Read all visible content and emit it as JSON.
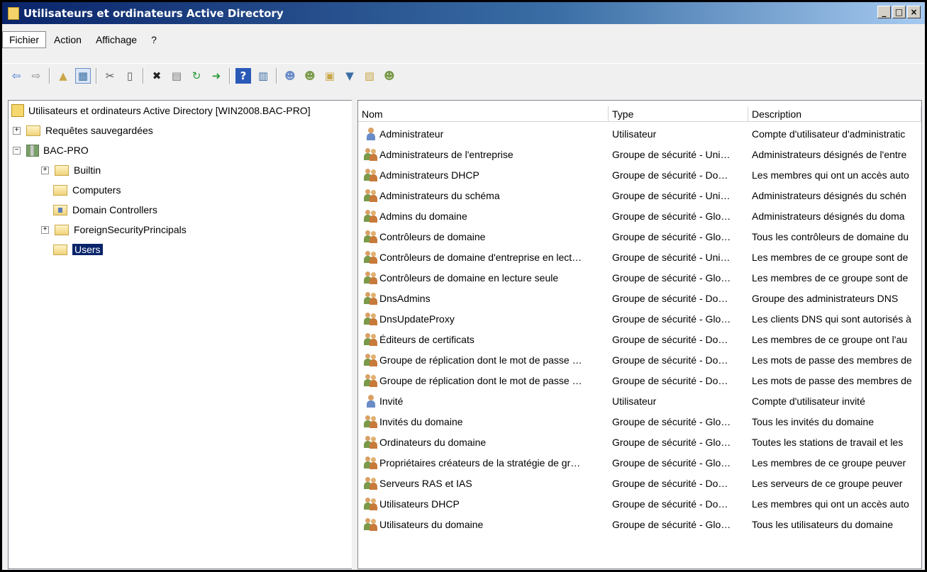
{
  "window": {
    "title": "Utilisateurs et ordinateurs Active Directory"
  },
  "window_buttons": [
    "_",
    "□",
    "×"
  ],
  "menu": [
    "Fichier",
    "Action",
    "Affichage",
    "?"
  ],
  "toolbar_icons": [
    "back-arrow-icon",
    "forward-arrow-icon",
    "up-folder-icon",
    "show-tree-icon",
    "cut-icon",
    "copy-icon",
    "delete-icon",
    "properties-icon",
    "refresh-icon",
    "export-icon",
    "help-icon",
    "view-icon",
    "new-user-icon",
    "new-group-icon",
    "new-ou-icon",
    "filter-icon",
    "add-to-group-icon",
    "find-icon"
  ],
  "tree": {
    "root": "Utilisateurs et ordinateurs Active Directory [WIN2008.BAC-PRO]",
    "saved_queries": "Requêtes sauvegardées",
    "domain": "BAC-PRO",
    "children": [
      "Builtin",
      "Computers",
      "Domain Controllers",
      "ForeignSecurityPrincipals",
      "Users"
    ],
    "selected": "Users"
  },
  "list": {
    "columns": [
      "Nom",
      "Type",
      "Description"
    ],
    "rows": [
      {
        "icon": "user",
        "name": "Administrateur",
        "type": "Utilisateur",
        "description": "Compte d'utilisateur d'administratic"
      },
      {
        "icon": "group",
        "name": "Administrateurs de l'entreprise",
        "type": "Groupe de sécurité - Uni…",
        "description": "Administrateurs désignés de l'entre"
      },
      {
        "icon": "group",
        "name": "Administrateurs DHCP",
        "type": "Groupe de sécurité - Do…",
        "description": "Les membres qui ont un accès auto"
      },
      {
        "icon": "group",
        "name": "Administrateurs du schéma",
        "type": "Groupe de sécurité - Uni…",
        "description": "Administrateurs désignés du schén"
      },
      {
        "icon": "group",
        "name": "Admins du domaine",
        "type": "Groupe de sécurité - Glo…",
        "description": "Administrateurs désignés du doma"
      },
      {
        "icon": "group",
        "name": "Contrôleurs de domaine",
        "type": "Groupe de sécurité - Glo…",
        "description": "Tous les contrôleurs de domaine du"
      },
      {
        "icon": "group",
        "name": "Contrôleurs de domaine d'entreprise en lect…",
        "type": "Groupe de sécurité - Uni…",
        "description": "Les membres de ce groupe sont de"
      },
      {
        "icon": "group",
        "name": "Contrôleurs de domaine en lecture seule",
        "type": "Groupe de sécurité - Glo…",
        "description": "Les membres de ce groupe sont de"
      },
      {
        "icon": "group",
        "name": "DnsAdmins",
        "type": "Groupe de sécurité - Do…",
        "description": "Groupe des administrateurs DNS"
      },
      {
        "icon": "group",
        "name": "DnsUpdateProxy",
        "type": "Groupe de sécurité - Glo…",
        "description": "Les clients DNS qui sont autorisés à"
      },
      {
        "icon": "group",
        "name": "Éditeurs de certificats",
        "type": "Groupe de sécurité - Do…",
        "description": "Les membres de ce groupe ont l'au"
      },
      {
        "icon": "group",
        "name": "Groupe de réplication dont le mot de passe …",
        "type": "Groupe de sécurité - Do…",
        "description": "Les mots de passe des membres de"
      },
      {
        "icon": "group",
        "name": "Groupe de réplication dont le mot de passe …",
        "type": "Groupe de sécurité - Do…",
        "description": "Les mots de passe des membres de"
      },
      {
        "icon": "user",
        "name": "Invité",
        "type": "Utilisateur",
        "description": "Compte d'utilisateur invité"
      },
      {
        "icon": "group",
        "name": "Invités du domaine",
        "type": "Groupe de sécurité - Glo…",
        "description": "Tous les invités du domaine"
      },
      {
        "icon": "group",
        "name": "Ordinateurs du domaine",
        "type": "Groupe de sécurité - Glo…",
        "description": "Toutes les stations de travail et les"
      },
      {
        "icon": "group",
        "name": "Propriétaires créateurs de la stratégie de gr…",
        "type": "Groupe de sécurité - Glo…",
        "description": "Les membres de ce groupe peuver"
      },
      {
        "icon": "group",
        "name": "Serveurs RAS et IAS",
        "type": "Groupe de sécurité - Do…",
        "description": "Les serveurs de ce groupe peuver"
      },
      {
        "icon": "group",
        "name": "Utilisateurs DHCP",
        "type": "Groupe de sécurité - Do…",
        "description": "Les membres qui ont un accès auto"
      },
      {
        "icon": "group",
        "name": "Utilisateurs du domaine",
        "type": "Groupe de sécurité - Glo…",
        "description": "Tous les utilisateurs du domaine"
      }
    ]
  }
}
